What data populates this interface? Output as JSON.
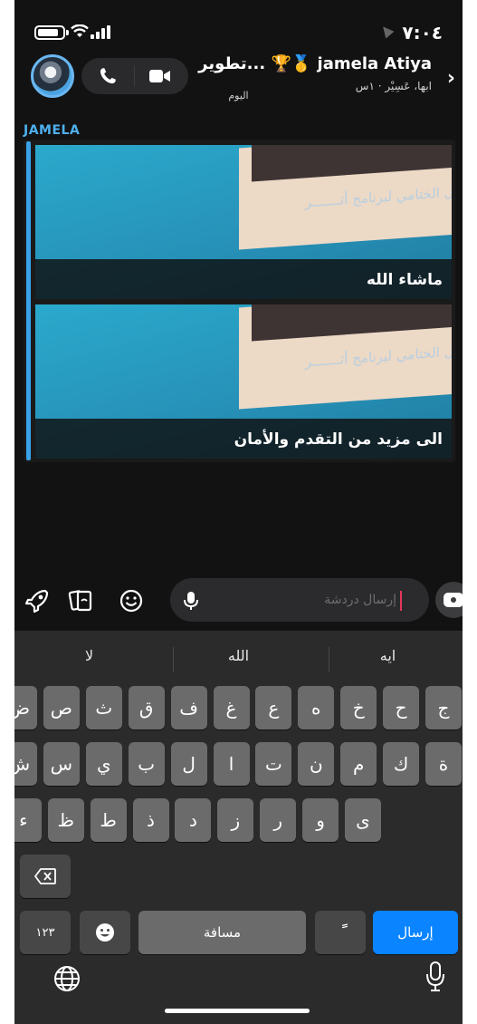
{
  "status_bar": {
    "time": "٧:٠٤"
  },
  "header": {
    "contact_name": "تطوير... 🏆🥇 jamela Atiya",
    "subtitle": "ابها، عَسِيْر · ١س"
  },
  "chat": {
    "day_label": "اليوم",
    "sender": "JAMELA",
    "snaps": [
      {
        "caption": "ماشاء الله",
        "overlay_text": "الحفل الختامي لبرنامج أثـــــــر"
      },
      {
        "caption": "الى مزيد من التقدم والأمان",
        "overlay_text": "الحفل الختامي لبرنامج أثـــــــر"
      }
    ]
  },
  "composer": {
    "placeholder": "إرسال دردشة"
  },
  "keyboard": {
    "suggestions": [
      "ايه",
      "الله",
      "لا"
    ],
    "row1": [
      "ج",
      "ح",
      "خ",
      "ه",
      "ع",
      "غ",
      "ف",
      "ق",
      "ث",
      "ص",
      "ض"
    ],
    "row2": [
      "ة",
      "ك",
      "م",
      "ن",
      "ت",
      "ا",
      "ل",
      "ب",
      "ي",
      "س",
      "ش"
    ],
    "row3": [
      "ى",
      "و",
      "ر",
      "ز",
      "د",
      "ذ",
      "ط",
      "ظ",
      "ء"
    ],
    "numbers_label": "١٢٣",
    "space_label": "مسافة",
    "tanween_label": "ًً",
    "send_label": "إرسال"
  },
  "colors": {
    "accent_blue": "#0a84ff",
    "sender_blue": "#4fb0ee",
    "cursor_red": "#e7345a",
    "background": "#121212"
  }
}
